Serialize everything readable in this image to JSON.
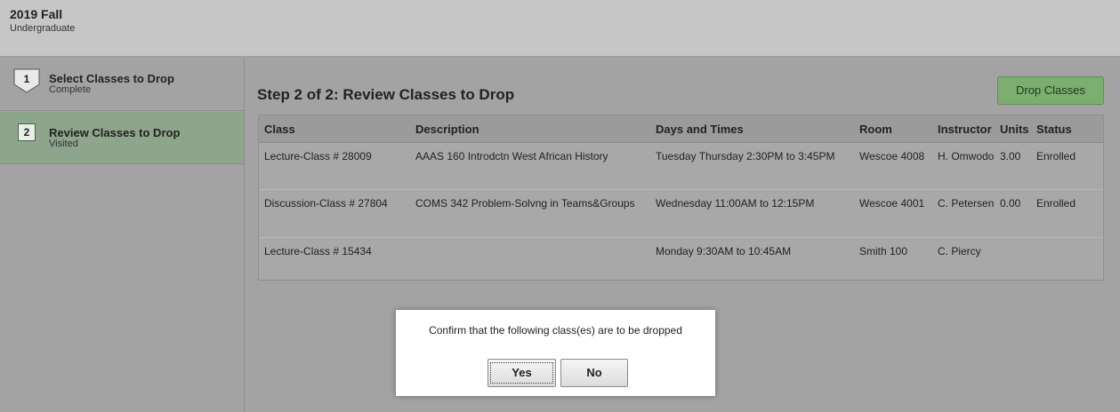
{
  "term": {
    "title": "2019 Fall",
    "career": "Undergraduate"
  },
  "steps": [
    {
      "number": "1",
      "title": "Select Classes to Drop",
      "status": "Complete"
    },
    {
      "number": "2",
      "title": "Review Classes to Drop",
      "status": "Visited"
    }
  ],
  "main": {
    "heading": "Step 2 of 2: Review Classes to Drop",
    "drop_button": "Drop Classes"
  },
  "table": {
    "headers": [
      "Class",
      "Description",
      "Days and Times",
      "Room",
      "Instructor",
      "Units",
      "Status"
    ],
    "rows": [
      [
        "Lecture-Class # 28009",
        "AAAS 160  Introdctn West African History",
        "Tuesday Thursday   2:30PM to 3:45PM",
        "Wescoe 4008",
        "H. Omwodo",
        "3.00",
        "Enrolled"
      ],
      [
        "Discussion-Class # 27804",
        "COMS 342  Problem-Solvng in Teams&Groups",
        "Wednesday   11:00AM to 12:15PM",
        "Wescoe 4001",
        "C. Petersen",
        "0.00",
        "Enrolled"
      ],
      [
        "Lecture-Class # 15434",
        "",
        "Monday   9:30AM to 10:45AM",
        "Smith 100",
        "C. Piercy",
        "",
        ""
      ]
    ]
  },
  "dialog": {
    "message": "Confirm that the following class(es) are to be dropped",
    "yes_label": "Yes",
    "no_label": "No"
  },
  "colors": {
    "active_step": "#8da58a",
    "drop_button": "#7cae6f",
    "background": "#a3a3a3"
  }
}
